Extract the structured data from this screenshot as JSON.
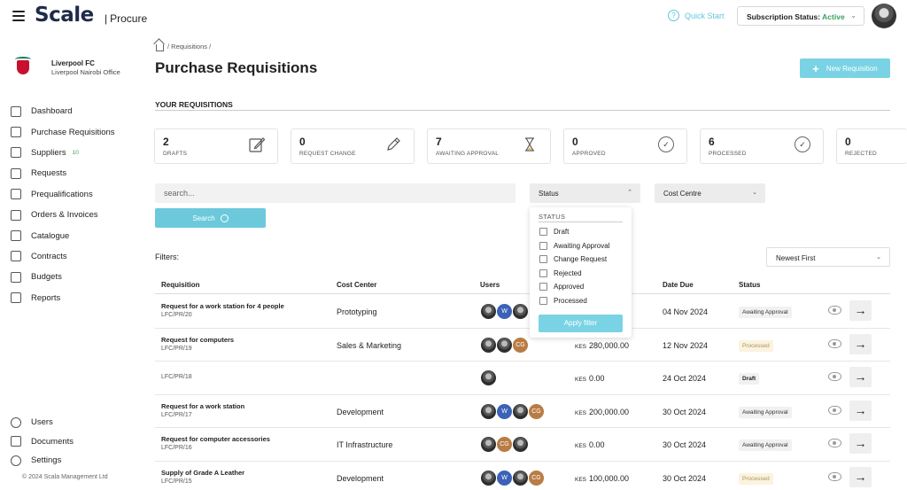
{
  "header": {
    "brand": "Scale",
    "product": "Procure",
    "quick_start": "Quick Start",
    "subscription_label": "Subscription Status:",
    "subscription_value": "Active"
  },
  "org": {
    "name": "Liverpool FC",
    "office": "Liverpool Nairobi Office"
  },
  "sidebar": {
    "items": [
      {
        "label": "Dashboard",
        "icon": "dashboard-icon"
      },
      {
        "label": "Purchase Requisitions",
        "icon": "edit-icon"
      },
      {
        "label": "Suppliers",
        "icon": "truck-icon",
        "badge": "10"
      },
      {
        "label": "Requests",
        "icon": "megaphone-icon"
      },
      {
        "label": "Prequalifications",
        "icon": "megaphone-icon"
      },
      {
        "label": "Orders & Invoices",
        "icon": "list-icon"
      },
      {
        "label": "Catalogue",
        "icon": "archive-icon"
      },
      {
        "label": "Contracts",
        "icon": "contract-icon"
      },
      {
        "label": "Budgets",
        "icon": "pie-icon"
      },
      {
        "label": "Reports",
        "icon": "grid-icon"
      }
    ],
    "bottom_items": [
      {
        "label": "Users",
        "icon": "user-icon"
      },
      {
        "label": "Documents",
        "icon": "document-icon"
      },
      {
        "label": "Settings",
        "icon": "gear-icon"
      }
    ],
    "copyright": "© 2024 Scala Management Ltd"
  },
  "breadcrumb": "/ Requisitions /",
  "page_title": "Purchase Requisitions",
  "new_button": "New Requisition",
  "section_title": "YOUR REQUISITIONS",
  "cards": [
    {
      "count": "2",
      "label": "DRAFTS"
    },
    {
      "count": "0",
      "label": "REQUEST CHANGE"
    },
    {
      "count": "7",
      "label": "AWAITING APPROVAL"
    },
    {
      "count": "0",
      "label": "APPROVED"
    },
    {
      "count": "6",
      "label": "PROCESSED"
    },
    {
      "count": "0",
      "label": "REJECTED"
    }
  ],
  "search": {
    "placeholder": "search...",
    "button": "Search"
  },
  "status_select": "Status",
  "cost_centre_select": "Cost Centre",
  "filters_label": "Filters:",
  "sort_select": "Newest First",
  "status_dropdown": {
    "title": "STATUS",
    "options": [
      "Draft",
      "Awaiting Approval",
      "Change Request",
      "Rejected",
      "Approved",
      "Processed"
    ],
    "apply": "Apply filter"
  },
  "table": {
    "columns": [
      "Requisition",
      "Cost Center",
      "Users",
      "Date Due",
      "Status"
    ],
    "rows": [
      {
        "title": "Request for a work station for 4 people",
        "code": "LFC/PR/20",
        "cost_center": "Prototyping",
        "currency": "",
        "amount": "",
        "due": "04 Nov 2024",
        "status": "Awaiting Approval"
      },
      {
        "title": "Request for computers",
        "code": "LFC/PR/19",
        "cost_center": "Sales & Marketing",
        "currency": "KES",
        "amount": "280,000.00",
        "due": "12 Nov 2024",
        "status": "Processed"
      },
      {
        "title": "",
        "code": "LFC/PR/18",
        "cost_center": "",
        "currency": "KES",
        "amount": "0.00",
        "due": "24 Oct 2024",
        "status": "Draft"
      },
      {
        "title": "Request for a work station",
        "code": "LFC/PR/17",
        "cost_center": "Development",
        "currency": "KES",
        "amount": "200,000.00",
        "due": "30 Oct 2024",
        "status": "Awaiting Approval"
      },
      {
        "title": "Request for computer accessories",
        "code": "LFC/PR/16",
        "cost_center": "IT Infrastructure",
        "currency": "KES",
        "amount": "0.00",
        "due": "30 Oct 2024",
        "status": "Awaiting Approval"
      },
      {
        "title": "Supply of Grade A Leather",
        "code": "LFC/PR/15",
        "cost_center": "Development",
        "currency": "KES",
        "amount": "100,000.00",
        "due": "30 Oct 2024",
        "status": "Processed"
      }
    ]
  },
  "user_badges": {
    "w": "W",
    "cg": "CG"
  },
  "colors": {
    "accent": "#6cc9dc",
    "active": "#3aa15b",
    "brand": "#1f2b4a"
  }
}
